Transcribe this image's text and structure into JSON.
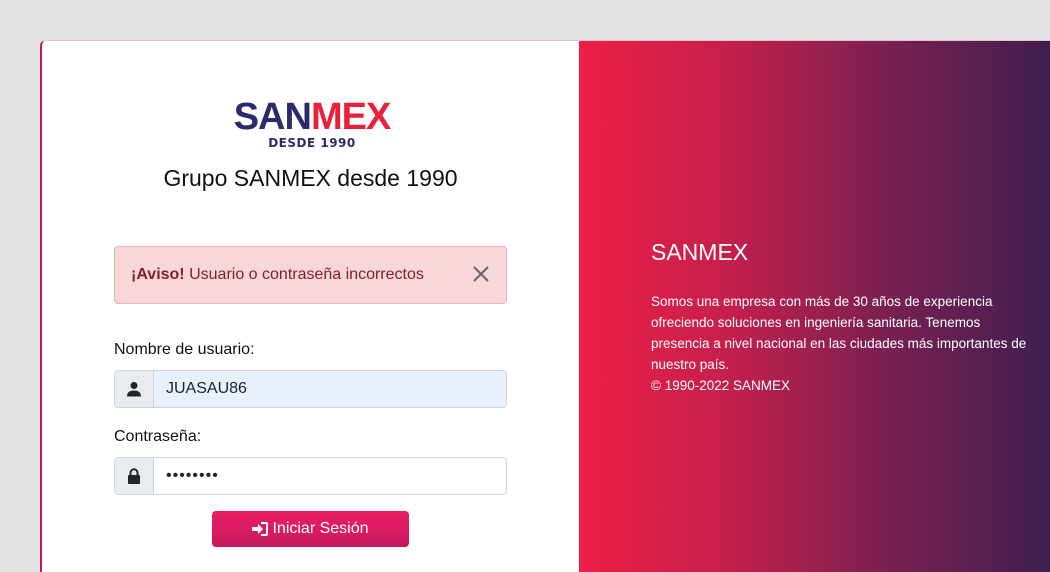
{
  "brand": {
    "logo_san": "SAN",
    "logo_mex": "MEX",
    "logo_sub": "DESDE 1990",
    "subtitle": "Grupo SANMEX desde 1990"
  },
  "alert": {
    "strong": "¡Aviso!",
    "message": "Usuario o contraseña incorrectos",
    "icon": "close-icon"
  },
  "form": {
    "username_label": "Nombre de usuario:",
    "username_value": "JUASAU86",
    "username_icon": "user-icon",
    "password_label": "Contraseña:",
    "password_value": "••••••••",
    "password_icon": "lock-icon",
    "submit_label": "Iniciar Sesión",
    "submit_icon": "sign-in-icon"
  },
  "info": {
    "title": "SANMEX",
    "description": "Somos una empresa con más de 30 años de experiencia ofreciendo soluciones en ingeniería sanitaria. Tenemos presencia a nivel nacional en las ciudades más importantes de nuestro país.",
    "copyright": "© 1990-2022 SANMEX"
  },
  "colors": {
    "accent": "#e91e63",
    "logo_navy": "#2c2a6c",
    "logo_red": "#e8213b",
    "alert_bg": "#f8d7da",
    "gradient_start": "#ee1f45",
    "gradient_end": "#3d1f4f"
  }
}
